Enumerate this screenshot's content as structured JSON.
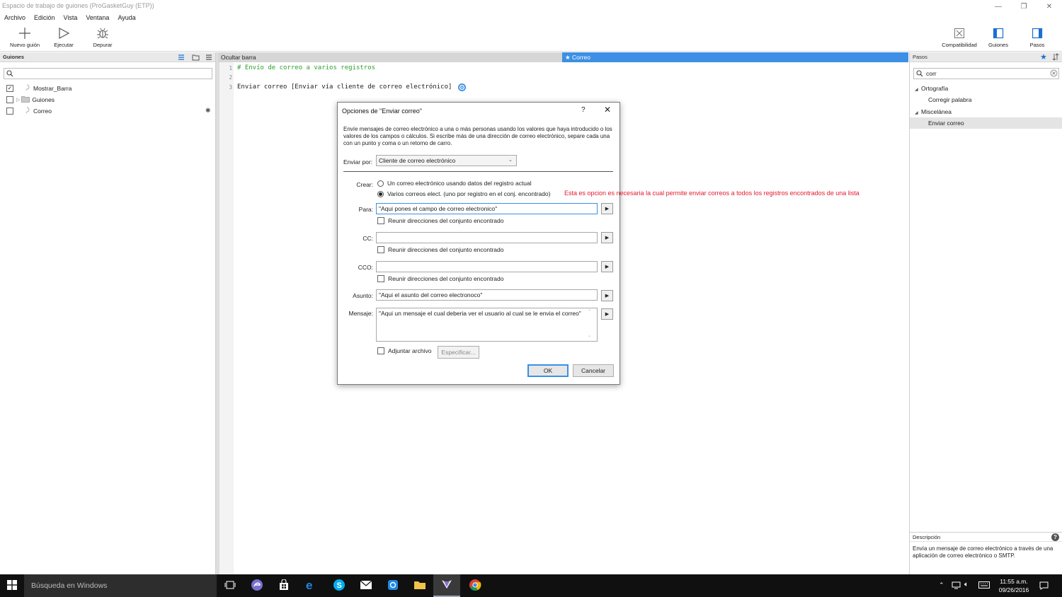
{
  "window": {
    "title": "Espacio de trabajo de guiones (ProGasketGuy (ETP))"
  },
  "menu": [
    "Archivo",
    "Edición",
    "Vista",
    "Ventana",
    "Ayuda"
  ],
  "toolbar": {
    "new_script": "Nuevo guión",
    "run": "Ejecutar",
    "debug": "Depurar",
    "compatibility": "Compatibilidad",
    "scripts": "Guiones",
    "steps": "Pasos"
  },
  "left_panel": {
    "title": "Guiones",
    "search_value": "",
    "items": [
      {
        "label": "Mostrar_Barra",
        "checked": true
      },
      {
        "label": "Guiones",
        "checked": false
      },
      {
        "label": "Correo",
        "checked": false
      }
    ]
  },
  "editor": {
    "hide_bar": "Ocultar barra",
    "tab": "Correo",
    "lines": [
      {
        "num": "1",
        "text": "# Envío de correo a varios registros"
      },
      {
        "num": "2",
        "text": ""
      },
      {
        "num": "3",
        "text": "Enviar correo [Enviar vía cliente de correo electrónico]"
      }
    ]
  },
  "right_panel": {
    "title": "Pasos",
    "search_value": "corr",
    "tree": [
      {
        "label": "Ortografía",
        "level": 0
      },
      {
        "label": "Corregir palabra",
        "level": 1
      },
      {
        "label": "Miscelánea",
        "level": 0
      },
      {
        "label": "Enviar correo",
        "level": 1
      }
    ],
    "description_title": "Descripción",
    "description": "Envía un mensaje de correo electrónico a través de una aplicación de correo electrónico o SMTP."
  },
  "dialog": {
    "title": "Opciones de \"Enviar correo\"",
    "help": "?",
    "description": "Envíe mensajes de correo electrónico a una o más personas usando los valores que haya introducido o los valores de los campos o cálculos. Si escribe más de una dirección de correo electrónico, separe cada una con un punto y coma o un retorno de carro.",
    "send_via_label": "Enviar por:",
    "send_via_value": "Cliente de correo electrónico",
    "create_label": "Crear:",
    "option_single": "Un correo electrónico usando datos del registro actual",
    "option_multi": "Varios correos elect. (uno por registro en el conj. encontrado)",
    "to_label": "Para:",
    "to_value": "\"Aqui pones el campo de correo electronico\"",
    "cc_label": "CC:",
    "cc_value": "",
    "bcc_label": "CCO:",
    "bcc_value": "",
    "collect_label": "Reunir direcciones del conjunto encontrado",
    "subject_label": "Asunto:",
    "subject_value": "\"Aqui el asunto del correo electronoco\"",
    "message_label": "Mensaje:",
    "message_value": "\"Aqui un mensaje el cual deberia ver el usuario al cual se le envia el correo\"",
    "attach_label": "Adjuntar archivo",
    "specify_button": "Especificar...",
    "ok_button": "OK",
    "cancel_button": "Cancelar"
  },
  "annotation": "Esta es opcion es necesaria la cual permite enviar correos a todos los registros encontrados de una lista",
  "taskbar": {
    "search": "Búsqueda en Windows",
    "time": "11:55 a.m.",
    "date": "09/26/2016"
  },
  "colors": {
    "accent": "#3c8fe4",
    "annotation": "#e3192f",
    "comment": "#2e9e2e",
    "taskbar": "#101010"
  }
}
